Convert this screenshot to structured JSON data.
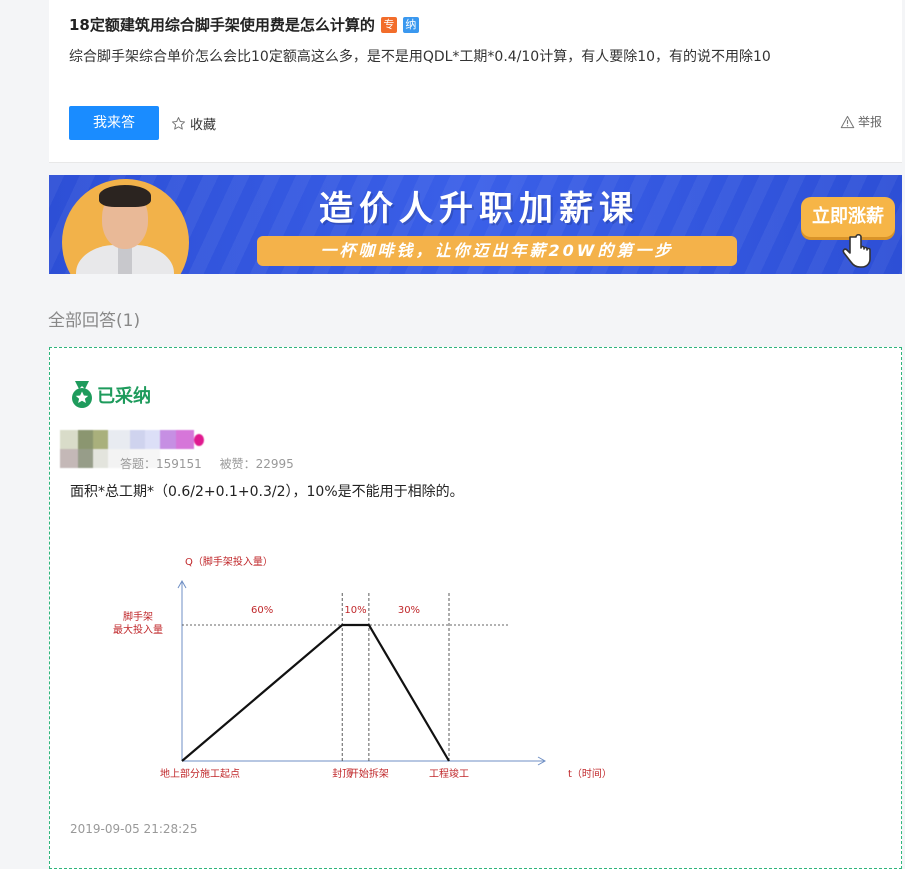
{
  "question": {
    "title": "18定额建筑用综合脚手架使用费是怎么计算的",
    "badge_zhuan": "专",
    "badge_na": "纳",
    "description": "综合脚手架综合单价怎么会比10定额高这么多，是不是用QDL*工期*0.4/10计算，有人要除10，有的说不用除10",
    "answer_button": "我来答",
    "favorite_label": "收藏",
    "report_label": "举报"
  },
  "banner": {
    "title": "造价人升职加薪课",
    "subtitle": "一杯咖啡钱，让你迈出年薪20W的第一步",
    "button": "立即涨薪",
    "colors": {
      "background": "#3355de",
      "accent": "#f6b547"
    }
  },
  "answers_header": "全部回答(1)",
  "answer": {
    "adopted_label": "已采纳",
    "stats_answers": "答题：159151",
    "stats_likes": "被赞：22995",
    "text": "面积*总工期*（0.6/2+0.1+0.3/2），10%是不能用于相除的。",
    "time": "2019-09-05 21:28:25"
  },
  "chart_data": {
    "type": "line",
    "ylabel": "Q（脚手架投入量）",
    "xlabel": "t（时间）",
    "y_marker_label": [
      "脚手架",
      "最大投入量"
    ],
    "x_points": [
      "地上部分施工起点",
      "封顶",
      "开始拆架",
      "工程竣工"
    ],
    "segment_labels": [
      "60%",
      "10%",
      "30%"
    ],
    "x": [
      0,
      60,
      70,
      100
    ],
    "y": [
      0,
      1,
      1,
      0
    ],
    "colors": {
      "axis": "#6f8fc4",
      "line": "#111111",
      "text": "#c0282b"
    }
  }
}
